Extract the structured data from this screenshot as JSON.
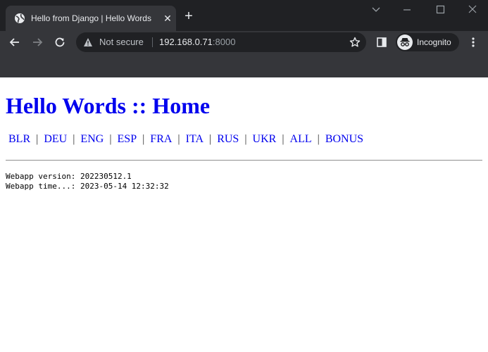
{
  "browser": {
    "tab_title": "Hello from Django | Hello Words",
    "tab_close": "✕",
    "new_tab": "+",
    "security_label": "Not secure",
    "url_host": "192.168.0.71",
    "url_port": ":8000",
    "profile_label": "Incognito",
    "icons": [
      "globe-icon",
      "close-icon",
      "plus-icon",
      "chevron-down-icon",
      "minimize-icon",
      "maximize-icon",
      "window-close-icon",
      "back-icon",
      "forward-icon",
      "reload-icon",
      "warning-icon",
      "star-icon",
      "side-panel-icon",
      "incognito-icon",
      "more-icon"
    ]
  },
  "page": {
    "title": "Hello Words :: Home",
    "nav": [
      "BLR",
      "DEU",
      "ENG",
      "ESP",
      "FRA",
      "ITA",
      "RUS",
      "UKR",
      "ALL",
      "BONUS"
    ],
    "separator": "|",
    "version_line": "Webapp version: 202230512.1",
    "time_line": "Webapp time...: 2023-05-14 12:32:32"
  },
  "colors": {
    "link": "#0000ee",
    "chrome_dark": "#202124",
    "chrome_mid": "#35363a"
  }
}
